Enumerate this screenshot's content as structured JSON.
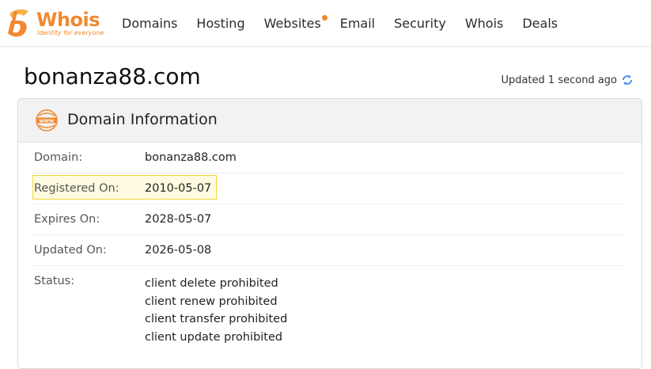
{
  "header": {
    "logo": {
      "name": "Whois",
      "tagline": "Identity for everyone"
    },
    "nav": [
      {
        "label": "Domains"
      },
      {
        "label": "Hosting"
      },
      {
        "label": "Websites",
        "has_dot": true
      },
      {
        "label": "Email"
      },
      {
        "label": "Security"
      },
      {
        "label": "Whois"
      },
      {
        "label": "Deals"
      }
    ]
  },
  "page": {
    "title": "bonanza88.com",
    "updated_text": "Updated 1 second ago"
  },
  "card": {
    "title": "Domain Information",
    "rows": [
      {
        "label": "Domain:",
        "value": "bonanza88.com"
      },
      {
        "label": "Registered On:",
        "value": "2010-05-07",
        "highlighted": true
      },
      {
        "label": "Expires On:",
        "value": "2028-05-07"
      },
      {
        "label": "Updated On:",
        "value": "2026-05-08"
      }
    ],
    "status": {
      "label": "Status:",
      "values": [
        "client delete prohibited",
        "client renew prohibited",
        "client transfer prohibited",
        "client update prohibited"
      ]
    }
  },
  "colors": {
    "brand": "#f0892f",
    "highlight_border": "#f0d73a",
    "refresh": "#3a8ee6"
  },
  "icons": [
    "whois-logo-icon",
    "www-globe-icon",
    "refresh-icon"
  ]
}
